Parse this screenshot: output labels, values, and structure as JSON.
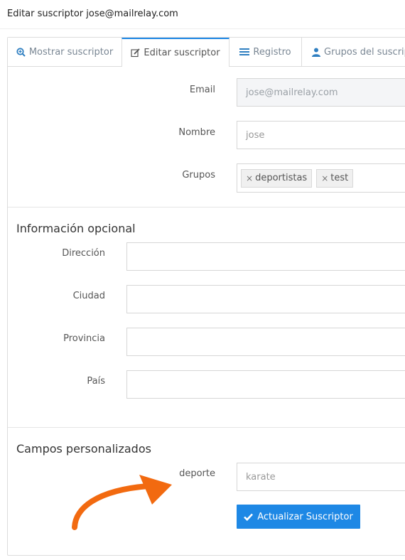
{
  "header": {
    "title": "Editar suscriptor jose@mailrelay.com"
  },
  "tabs": [
    {
      "label": "Mostrar suscriptor",
      "icon": "zoom-in-icon"
    },
    {
      "label": "Editar suscriptor",
      "icon": "edit-icon",
      "active": true
    },
    {
      "label": "Registro",
      "icon": "list-icon"
    },
    {
      "label": "Grupos del suscrip",
      "icon": "user-icon"
    }
  ],
  "form": {
    "email_label": "Email",
    "email_value": "jose@mailrelay.com",
    "nombre_label": "Nombre",
    "nombre_value": "jose",
    "grupos_label": "Grupos",
    "grupos": [
      "deportistas",
      "test"
    ],
    "tag_remove_glyph": "×"
  },
  "optional": {
    "heading": "Información opcional",
    "direccion_label": "Dirección",
    "direccion_value": "",
    "ciudad_label": "Ciudad",
    "ciudad_value": "",
    "provincia_label": "Provincia",
    "provincia_value": "",
    "pais_label": "País",
    "pais_value": ""
  },
  "custom": {
    "heading": "Campos personalizados",
    "deporte_label": "deporte",
    "deporte_placeholder": "karate"
  },
  "actions": {
    "update_label": "Actualizar Suscriptor"
  },
  "colors": {
    "accent": "#1e88e5",
    "arrow": "#f26a10"
  }
}
